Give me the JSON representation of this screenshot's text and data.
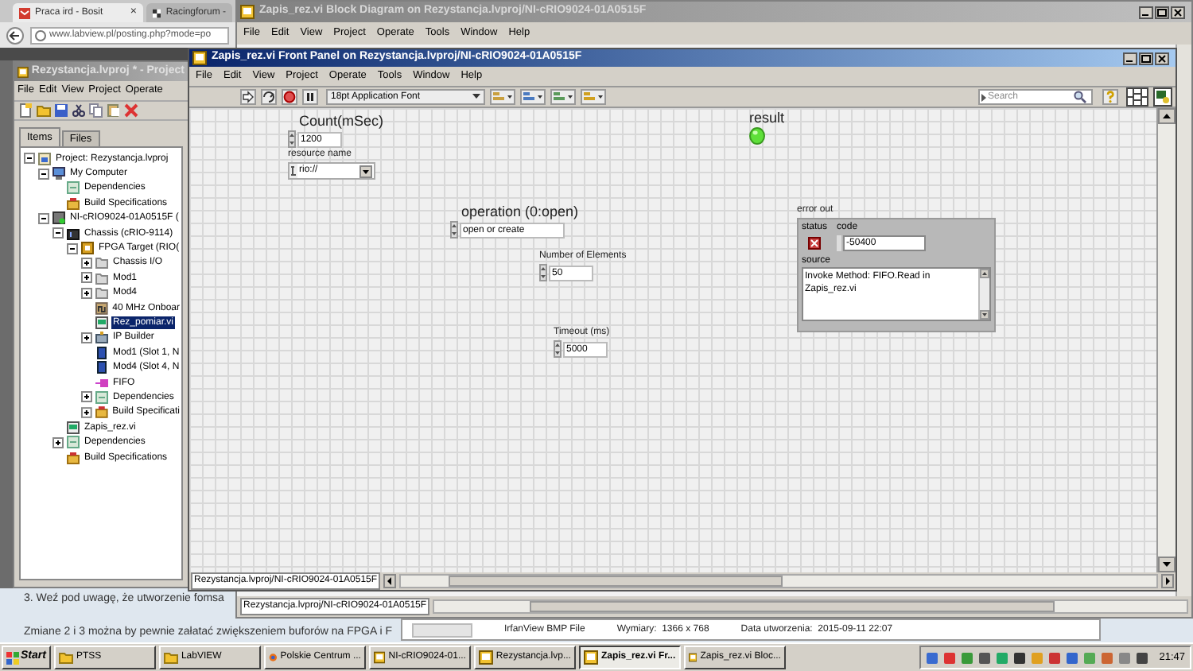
{
  "browser": {
    "tabs": [
      {
        "label": "Praca ird - Bosit",
        "selected": true,
        "close": "×"
      },
      {
        "label": "Racingforum -",
        "selected": false
      }
    ],
    "address": "www.labview.pl/posting.php?mode=po",
    "page_text": [
      "3. Weź pod uwagę, że utworzenie fomsa",
      "Zmiane 2 i 3 można by pewnie załatać zwiększeniem buforów na FPGA i F"
    ]
  },
  "project_window": {
    "title": "Rezystancja.lvproj * - Project",
    "menu": [
      "File",
      "Edit",
      "View",
      "Project",
      "Operate"
    ],
    "tabs": [
      {
        "label": "Items",
        "selected": true
      },
      {
        "label": "Files",
        "selected": false
      }
    ],
    "tree": [
      {
        "label": "Project: Rezystancja.lvproj",
        "kind": "project",
        "expanded": true,
        "selected": false,
        "children": [
          {
            "label": "My Computer",
            "kind": "computer",
            "expanded": true,
            "selected": false,
            "children": [
              {
                "label": "Dependencies",
                "kind": "dependencies",
                "selected": false
              },
              {
                "label": "Build Specifications",
                "kind": "build",
                "selected": false
              }
            ]
          },
          {
            "label": "NI-cRIO9024-01A0515F (",
            "kind": "target",
            "expanded": true,
            "selected": false,
            "children": [
              {
                "label": "Chassis (cRIO-9114)",
                "kind": "chassis",
                "expanded": true,
                "selected": false,
                "children": [
                  {
                    "label": "FPGA Target (RIO(",
                    "kind": "fpga",
                    "expanded": true,
                    "selected": false,
                    "children": [
                      {
                        "label": "Chassis I/O",
                        "kind": "folder",
                        "expanded": false,
                        "selected": false
                      },
                      {
                        "label": "Mod1",
                        "kind": "folder",
                        "expanded": false,
                        "selected": false
                      },
                      {
                        "label": "Mod4",
                        "kind": "folder",
                        "expanded": false,
                        "selected": false
                      },
                      {
                        "label": "40 MHz Onboar",
                        "kind": "clock",
                        "selected": false
                      },
                      {
                        "label": "Rez_pomiar.vi",
                        "kind": "vi",
                        "selected": true
                      },
                      {
                        "label": "IP Builder",
                        "kind": "ip",
                        "expanded": false,
                        "selected": false
                      },
                      {
                        "label": "Mod1 (Slot 1, N",
                        "kind": "module",
                        "selected": false
                      },
                      {
                        "label": "Mod4 (Slot 4, N",
                        "kind": "module",
                        "selected": false
                      },
                      {
                        "label": "FIFO",
                        "kind": "fifo",
                        "selected": false
                      },
                      {
                        "label": "Dependencies",
                        "kind": "dependencies",
                        "expanded": false,
                        "selected": false
                      },
                      {
                        "label": "Build Specificati",
                        "kind": "build",
                        "expanded": false,
                        "selected": false
                      }
                    ]
                  }
                ]
              },
              {
                "label": "Zapis_rez.vi",
                "kind": "vi",
                "selected": false
              },
              {
                "label": "Dependencies",
                "kind": "dependencies",
                "expanded": false,
                "selected": false
              },
              {
                "label": "Build Specifications",
                "kind": "build",
                "selected": false
              }
            ]
          }
        ]
      }
    ]
  },
  "block_diagram_window": {
    "title": "Zapis_rez.vi Block Diagram on Rezystancja.lvproj/NI-cRIO9024-01A0515F",
    "menu": [
      "File",
      "Edit",
      "View",
      "Project",
      "Operate",
      "Tools",
      "Window",
      "Help"
    ],
    "path": "Rezystancja.lvproj/NI-cRIO9024-01A0515F"
  },
  "front_panel_window": {
    "title": "Zapis_rez.vi Front Panel on Rezystancja.lvproj/NI-cRIO9024-01A0515F",
    "menu": [
      "File",
      "Edit",
      "View",
      "Project",
      "Operate",
      "Tools",
      "Window",
      "Help"
    ],
    "font_menu": "18pt Application Font",
    "search": {
      "placeholder": "Search"
    },
    "controls": [
      {
        "kind": "numeric",
        "label": "Count(mSec)",
        "value": "1200"
      },
      {
        "kind": "combo",
        "label": "resource name",
        "value": "rio://"
      },
      {
        "kind": "ring",
        "label": "operation (0:open)",
        "value": "open or create"
      },
      {
        "kind": "numeric",
        "label": "Number of Elements",
        "value": "50"
      },
      {
        "kind": "numeric",
        "label": "Timeout (ms)",
        "value": "5000"
      },
      {
        "kind": "led",
        "label": "result",
        "on": true
      },
      {
        "kind": "error",
        "label": "error out",
        "status_label": "status",
        "status": true,
        "code_label": "code",
        "code": "-50400",
        "source_label": "source",
        "source": "Invoke Method: FIFO.Read in Zapis_rez.vi"
      }
    ],
    "path": "Rezystancja.lvproj/NI-cRIO9024-01A0515F"
  },
  "image_info": [
    "IrfanView BMP File",
    "Wymiary:  1366 x 768",
    "Data utworzenia:  2015-09-11 22:07"
  ],
  "taskbar": {
    "start": "Start",
    "items": [
      {
        "label": "PTSS",
        "selected": false
      },
      {
        "label": "LabVIEW",
        "selected": false
      },
      {
        "label": "Polskie Centrum ...",
        "selected": false
      },
      {
        "label": "NI-cRIO9024-01...",
        "selected": false
      },
      {
        "label": "Rezystancja.lvp...",
        "selected": false
      },
      {
        "label": "Zapis_rez.vi Fr...",
        "selected": true
      },
      {
        "label": "Zapis_rez.vi Bloc...",
        "selected": false
      }
    ],
    "clock": "21:47"
  }
}
